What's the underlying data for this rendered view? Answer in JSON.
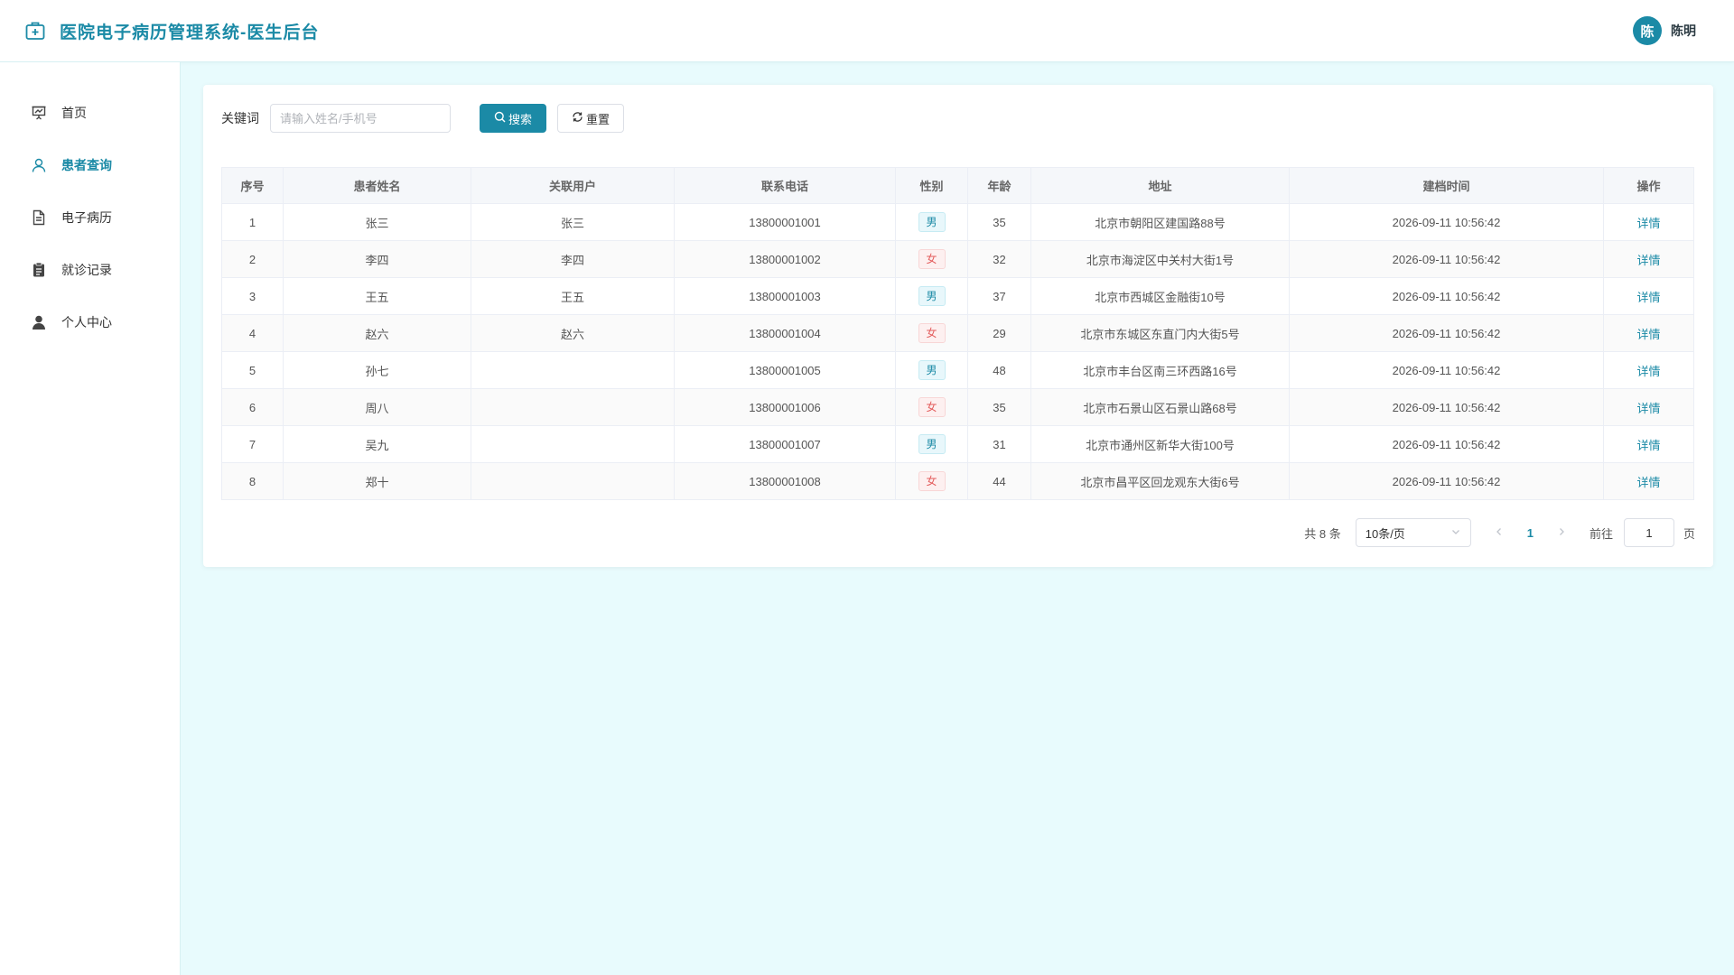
{
  "header": {
    "title": "医院电子病历管理系统-医生后台",
    "user": {
      "avatar_char": "陈",
      "name": "陈明"
    }
  },
  "sidebar": {
    "items": [
      {
        "label": "首页",
        "icon": "presentation-chart-icon",
        "active": false
      },
      {
        "label": "患者查询",
        "icon": "user-icon",
        "active": true
      },
      {
        "label": "电子病历",
        "icon": "document-icon",
        "active": false
      },
      {
        "label": "就诊记录",
        "icon": "clipboard-icon",
        "active": false
      },
      {
        "label": "个人中心",
        "icon": "person-icon",
        "active": false
      }
    ]
  },
  "search": {
    "label": "关键词",
    "placeholder": "请输入姓名/手机号",
    "value": "",
    "search_button": "搜索",
    "reset_button": "重置"
  },
  "table": {
    "columns": [
      "序号",
      "患者姓名",
      "关联用户",
      "联系电话",
      "性别",
      "年龄",
      "地址",
      "建档时间",
      "操作"
    ],
    "rows": [
      {
        "no": "1",
        "name": "张三",
        "user": "张三",
        "phone": "13800001001",
        "gender": "男",
        "age": "35",
        "address": "北京市朝阳区建国路88号",
        "created": "2026-09-11 10:56:42",
        "action": "详情"
      },
      {
        "no": "2",
        "name": "李四",
        "user": "李四",
        "phone": "13800001002",
        "gender": "女",
        "age": "32",
        "address": "北京市海淀区中关村大街1号",
        "created": "2026-09-11 10:56:42",
        "action": "详情"
      },
      {
        "no": "3",
        "name": "王五",
        "user": "王五",
        "phone": "13800001003",
        "gender": "男",
        "age": "37",
        "address": "北京市西城区金融街10号",
        "created": "2026-09-11 10:56:42",
        "action": "详情"
      },
      {
        "no": "4",
        "name": "赵六",
        "user": "赵六",
        "phone": "13800001004",
        "gender": "女",
        "age": "29",
        "address": "北京市东城区东直门内大街5号",
        "created": "2026-09-11 10:56:42",
        "action": "详情"
      },
      {
        "no": "5",
        "name": "孙七",
        "user": "",
        "phone": "13800001005",
        "gender": "男",
        "age": "48",
        "address": "北京市丰台区南三环西路16号",
        "created": "2026-09-11 10:56:42",
        "action": "详情"
      },
      {
        "no": "6",
        "name": "周八",
        "user": "",
        "phone": "13800001006",
        "gender": "女",
        "age": "35",
        "address": "北京市石景山区石景山路68号",
        "created": "2026-09-11 10:56:42",
        "action": "详情"
      },
      {
        "no": "7",
        "name": "吴九",
        "user": "",
        "phone": "13800001007",
        "gender": "男",
        "age": "31",
        "address": "北京市通州区新华大街100号",
        "created": "2026-09-11 10:56:42",
        "action": "详情"
      },
      {
        "no": "8",
        "name": "郑十",
        "user": "",
        "phone": "13800001008",
        "gender": "女",
        "age": "44",
        "address": "北京市昌平区回龙观东大街6号",
        "created": "2026-09-11 10:56:42",
        "action": "详情"
      }
    ]
  },
  "pagination": {
    "total_text": "共 8 条",
    "page_size": "10条/页",
    "current_page": "1",
    "goto_label": "前往",
    "goto_value": "1",
    "page_suffix": "页"
  },
  "colors": {
    "accent": "#1b8aa6",
    "male_tag": "#1b8aa6",
    "female_tag": "#e35d5d",
    "background": "#e8fbfd"
  }
}
